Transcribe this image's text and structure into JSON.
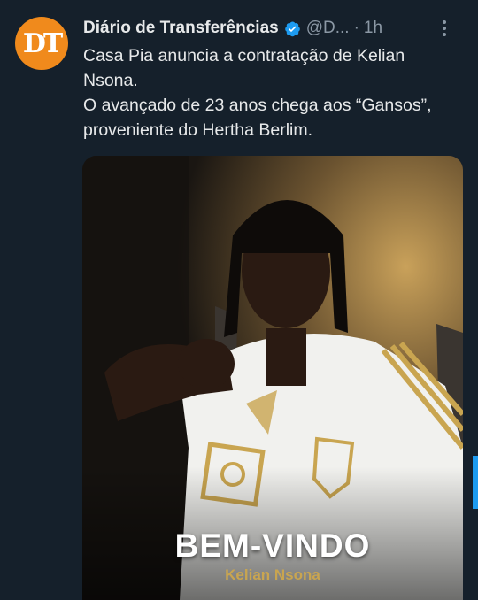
{
  "tweet": {
    "author_name": "Diário de Transferências",
    "handle": "@D...",
    "separator": "·",
    "time": "1h",
    "avatar_initials": "DT",
    "lines": [
      "Casa Pia anuncia a contratação de Kelian Nsona.",
      "O avançado de 23 anos chega aos “Gansos”, proveniente do Hertha Berlim."
    ],
    "media": {
      "title": "BEM-VINDO",
      "subtitle": "Kelian Nsona"
    }
  },
  "colors": {
    "background": "#15202b",
    "avatar": "#f08a1c",
    "verified": "#1d9bf0",
    "gold": "#c9a550"
  },
  "icons": {
    "verified": "verified-badge-icon",
    "more": "more-options-icon"
  }
}
